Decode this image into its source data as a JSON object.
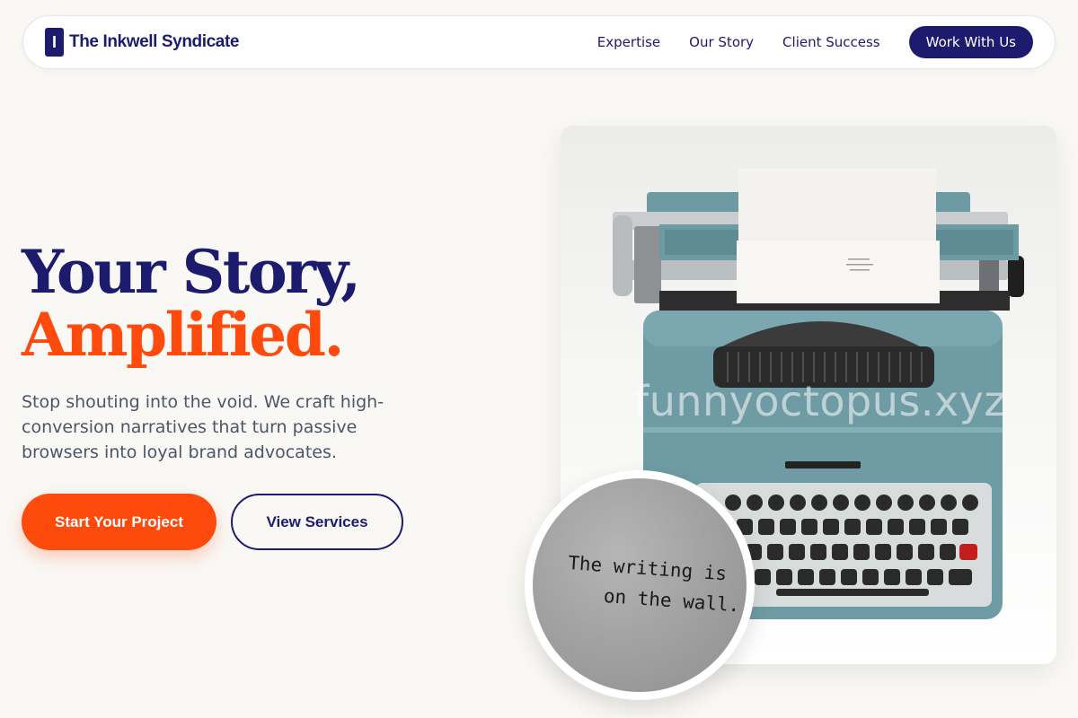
{
  "brand": {
    "mark": "I",
    "name": "The Inkwell Syndicate"
  },
  "nav": {
    "links": [
      "Expertise",
      "Our Story",
      "Client Success"
    ],
    "cta": "Work With Us"
  },
  "hero": {
    "title_line1": "Your Story,",
    "title_line2": "Amplified.",
    "subtitle": "Stop shouting into the void. We craft high-conversion narratives that turn passive browsers into loyal brand advocates.",
    "primary_button": "Start Your Project",
    "secondary_button": "View Services"
  },
  "image": {
    "watermark": "funnyoctopus.xyz",
    "inset_text_line1": "The writing is",
    "inset_text_line2": "on the wall."
  },
  "colors": {
    "navy": "#1d1b6e",
    "orange": "#fe4a0c",
    "background": "#f9f8f5",
    "typewriter": "#6d9ba3"
  }
}
